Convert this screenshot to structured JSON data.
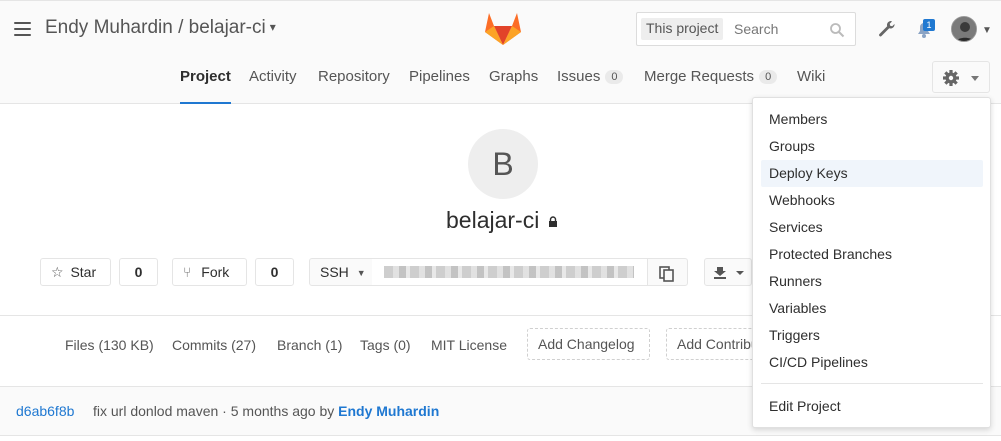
{
  "header": {
    "namespace": "Endy Muhardin",
    "separator": "/",
    "project": "belajar-ci",
    "chevron": "⌄",
    "search_scope": "This project",
    "search_placeholder": "Search",
    "notification_count": "1",
    "brand_color": "#e24329"
  },
  "nav": {
    "tabs": [
      {
        "label": "Project",
        "active": true
      },
      {
        "label": "Activity"
      },
      {
        "label": "Repository"
      },
      {
        "label": "Pipelines"
      },
      {
        "label": "Graphs"
      },
      {
        "label": "Issues",
        "count": "0"
      },
      {
        "label": "Merge Requests",
        "count": "0"
      },
      {
        "label": "Wiki"
      }
    ]
  },
  "project": {
    "avatar_letter": "B",
    "name": "belajar-ci",
    "star_label": "Star",
    "star_count": "0",
    "fork_label": "Fork",
    "fork_count": "0",
    "clone_protocol": "SSH"
  },
  "stats": {
    "files": "Files (130 KB)",
    "commits": "Commits (27)",
    "branch": "Branch (1)",
    "tags": "Tags (0)",
    "license": "MIT License",
    "add_changelog": "Add Changelog",
    "add_contrib": "Add Contribution guide"
  },
  "commit": {
    "sha": "d6ab6f8b",
    "message": "fix url donlod maven · 5 months ago by",
    "author": "Endy Muhardin"
  },
  "settings_menu": {
    "items": [
      "Members",
      "Groups",
      "Deploy Keys",
      "Webhooks",
      "Services",
      "Protected Branches",
      "Runners",
      "Variables",
      "Triggers",
      "CI/CD Pipelines"
    ],
    "hovered": "Deploy Keys",
    "edit_label": "Edit Project"
  }
}
